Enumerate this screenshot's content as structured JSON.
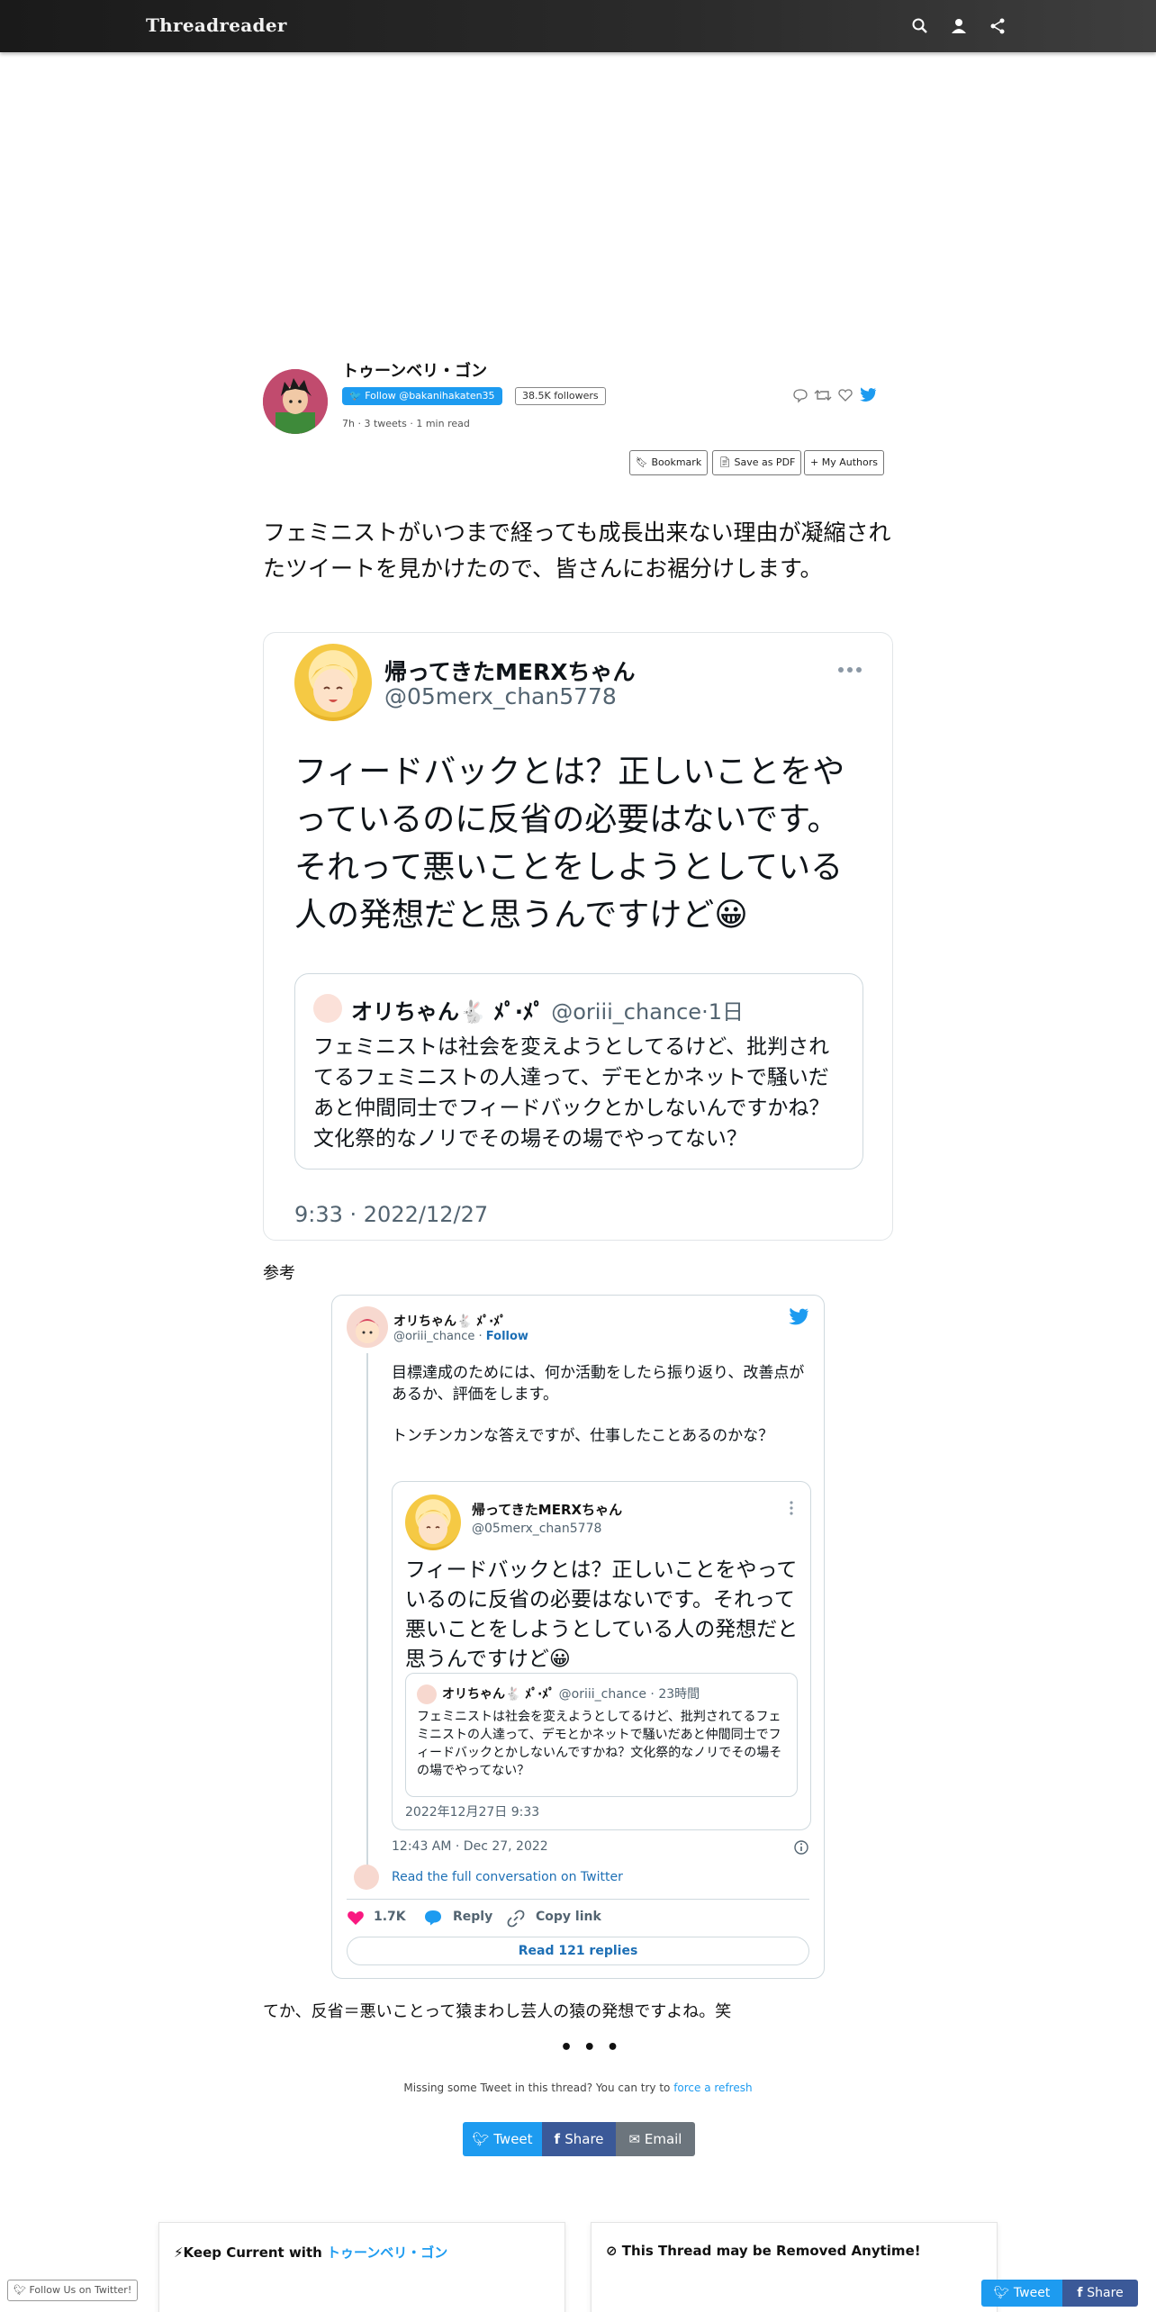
{
  "app": {
    "brand": "Threadreader"
  },
  "header": {
    "author_name": "トゥーンベリ・ゴン",
    "follow_label": "Follow @bakanihakaten35",
    "followers": "38.5K followers",
    "meta": "7h · 3 tweets · 1 min read",
    "buttons": {
      "bookmark": "Bookmark",
      "pdf": "Save as PDF",
      "authors": "My Authors"
    }
  },
  "thread": {
    "lead_text": "フェミニストがいつまで経っても成長出来ない理由が凝縮されたツイートを見かけたので、皆さんにお裾分けします。",
    "screenshot": {
      "name": "帰ってきたMERXちゃん",
      "handle": "@05merx_chan5778",
      "text": "フィードバックとは？正しいことをやっているのに反省の必要はないです。それって悪いことをしようとしている人の発想だと思うんですけど😀",
      "quote": {
        "name": "オリちゃん🐇 ﾒﾟ‧ﾒﾟ",
        "handle": "@oriii_chance",
        "time": "·1日",
        "text": "フェミニストは社会を変えようとしてるけど、批判されてるフェミニストの人達って、デモとかネットで騒いだあと仲間同士でフィードバックとかしないんですかね？文化祭的なノリでその場その場でやってない？"
      },
      "timestamp": "9:33 · 2022/12/27"
    },
    "ref_label": "参考",
    "embed": {
      "name": "オリちゃん🐇 ﾒﾟ‧ﾒﾟ",
      "handle": "@oriii_chance",
      "follow": "Follow",
      "para1": "目標達成のためには、何か活動をしたら振り返り、改善点があるか、評価をします。",
      "para2": "トンチンカンな答えですが、仕事したことあるのかな？",
      "quote": {
        "name": "帰ってきたMERXちゃん",
        "handle": "@05merx_chan5778",
        "text": "フィードバックとは？正しいことをやっているのに反省の必要はないです。それって悪いことをしようとしている人の発想だと思うんですけど😀",
        "inner_name": "オリちゃん🐇 ﾒﾟ‧ﾒﾟ",
        "inner_meta": "@oriii_chance · 23時間",
        "inner_text": "フェミニストは社会を変えようとしてるけど、批判されてるフェミニストの人達って、デモとかネットで騒いだあと仲間同士でフィードバックとかしないんですかね？文化祭的なノリでその場その場でやってない？",
        "time": "2022年12月27日 9:33"
      },
      "date": "12:43 AM · Dec 27, 2022",
      "read_full": "Read the full conversation on Twitter",
      "likes": "1.7K",
      "reply": "Reply",
      "copy": "Copy link",
      "replies": "Read 121 replies"
    },
    "closing_text": "てか、反省＝悪いことって猿まわし芸人の猿の発想ですよね。笑",
    "ellipsis": "• • •"
  },
  "footer": {
    "missing_text": "Missing some Tweet in this thread? You can try to ",
    "missing_link": "force a refresh",
    "share": {
      "tweet": "Tweet",
      "share": "Share",
      "email": "Email"
    },
    "card_left_prefix": "Keep Current with ",
    "card_left_author": "トゥーンベリ・ゴン",
    "card_right": "This Thread may be Removed Anytime!",
    "follow_us": "Follow Us on Twitter!",
    "fixed_tweet": "Tweet",
    "fixed_share": "Share"
  },
  "colors": {
    "twitter_blue": "#1d9bf0",
    "facebook": "#3b5998",
    "email": "#6c757d",
    "like_pink": "#f91880"
  }
}
